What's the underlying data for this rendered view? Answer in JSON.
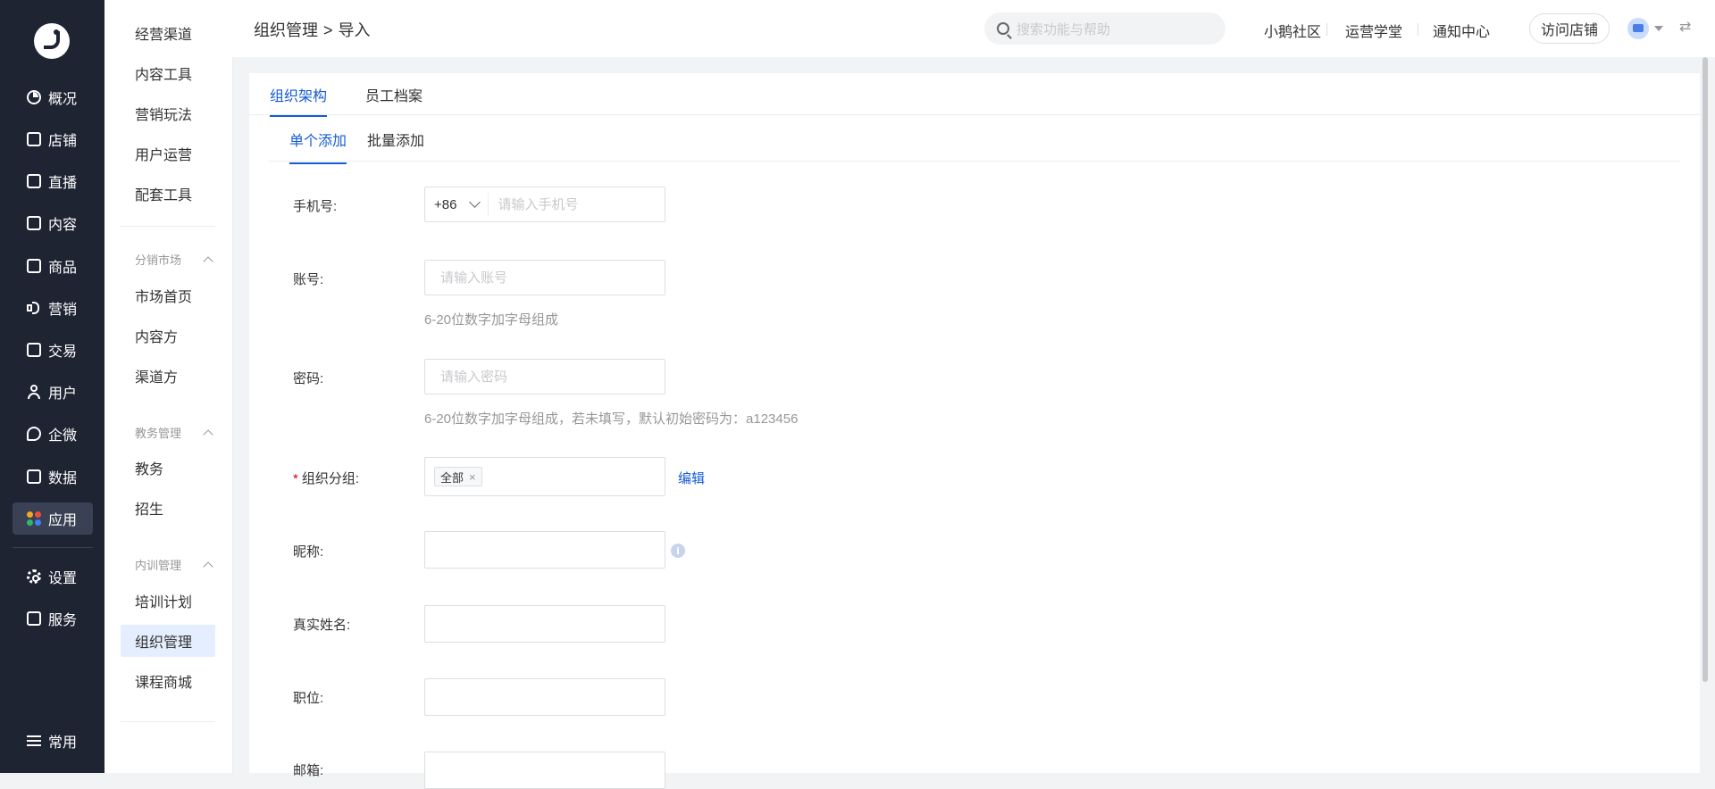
{
  "rail": {
    "items": [
      {
        "label": "概况",
        "icon": "dashboard-icon"
      },
      {
        "label": "店铺",
        "icon": "store-icon"
      },
      {
        "label": "直播",
        "icon": "live-icon"
      },
      {
        "label": "内容",
        "icon": "content-icon"
      },
      {
        "label": "商品",
        "icon": "product-icon"
      },
      {
        "label": "营销",
        "icon": "marketing-icon"
      },
      {
        "label": "交易",
        "icon": "trade-icon"
      },
      {
        "label": "用户",
        "icon": "user-icon"
      },
      {
        "label": "企微",
        "icon": "wecom-icon"
      },
      {
        "label": "数据",
        "icon": "data-icon"
      },
      {
        "label": "应用",
        "icon": "apps-icon"
      },
      {
        "label": "设置",
        "icon": "settings-icon"
      },
      {
        "label": "服务",
        "icon": "service-icon"
      },
      {
        "label": "常用",
        "icon": "favorites-icon"
      }
    ],
    "active": "应用"
  },
  "subnav": {
    "top_items": [
      "经营渠道",
      "内容工具",
      "营销玩法",
      "用户运营",
      "配套工具"
    ],
    "groups": [
      {
        "title": "分销市场",
        "items": [
          "市场首页",
          "内容方",
          "渠道方"
        ]
      },
      {
        "title": "教务管理",
        "items": [
          "教务",
          "招生"
        ]
      },
      {
        "title": "内训管理",
        "items": [
          "培训计划",
          "组织管理",
          "课程商城"
        ]
      }
    ],
    "active": "组织管理"
  },
  "header": {
    "crumb_parent": "组织管理",
    "crumb_sep": ">",
    "crumb_current": "导入",
    "search_placeholder": "搜索功能与帮助",
    "links": [
      "小鹅社区",
      "运营学堂",
      "通知中心"
    ],
    "visit_button": "访问店铺"
  },
  "tabs": {
    "primary": [
      "组织架构",
      "员工档案"
    ],
    "primary_active": "组织架构"
  },
  "subtabs": {
    "items": [
      "单个添加",
      "批量添加"
    ],
    "active": "单个添加"
  },
  "form": {
    "phone": {
      "label": "手机号:",
      "country_code": "+86",
      "placeholder": "请输入手机号",
      "value": ""
    },
    "account": {
      "label": "账号:",
      "placeholder": "请输入账号",
      "help": "6-20位数字加字母组成",
      "value": ""
    },
    "password": {
      "label": "密码:",
      "placeholder": "请输入密码",
      "help": "6-20位数字加字母组成，若未填写，默认初始密码为：a123456",
      "value": ""
    },
    "group": {
      "required_mark": "*",
      "label": "组织分组:",
      "tag": "全部",
      "tag_close": "×",
      "edit_link": "编辑"
    },
    "nickname": {
      "label": "昵称:",
      "value": "",
      "info": "i"
    },
    "real_name": {
      "label": "真实姓名:",
      "value": ""
    },
    "position": {
      "label": "职位:",
      "value": ""
    },
    "email": {
      "label": "邮箱:",
      "value": ""
    }
  },
  "colors": {
    "rail_bg": "#1f2433",
    "accent": "#155bd4",
    "required": "#d40000",
    "help_text": "#969799"
  }
}
